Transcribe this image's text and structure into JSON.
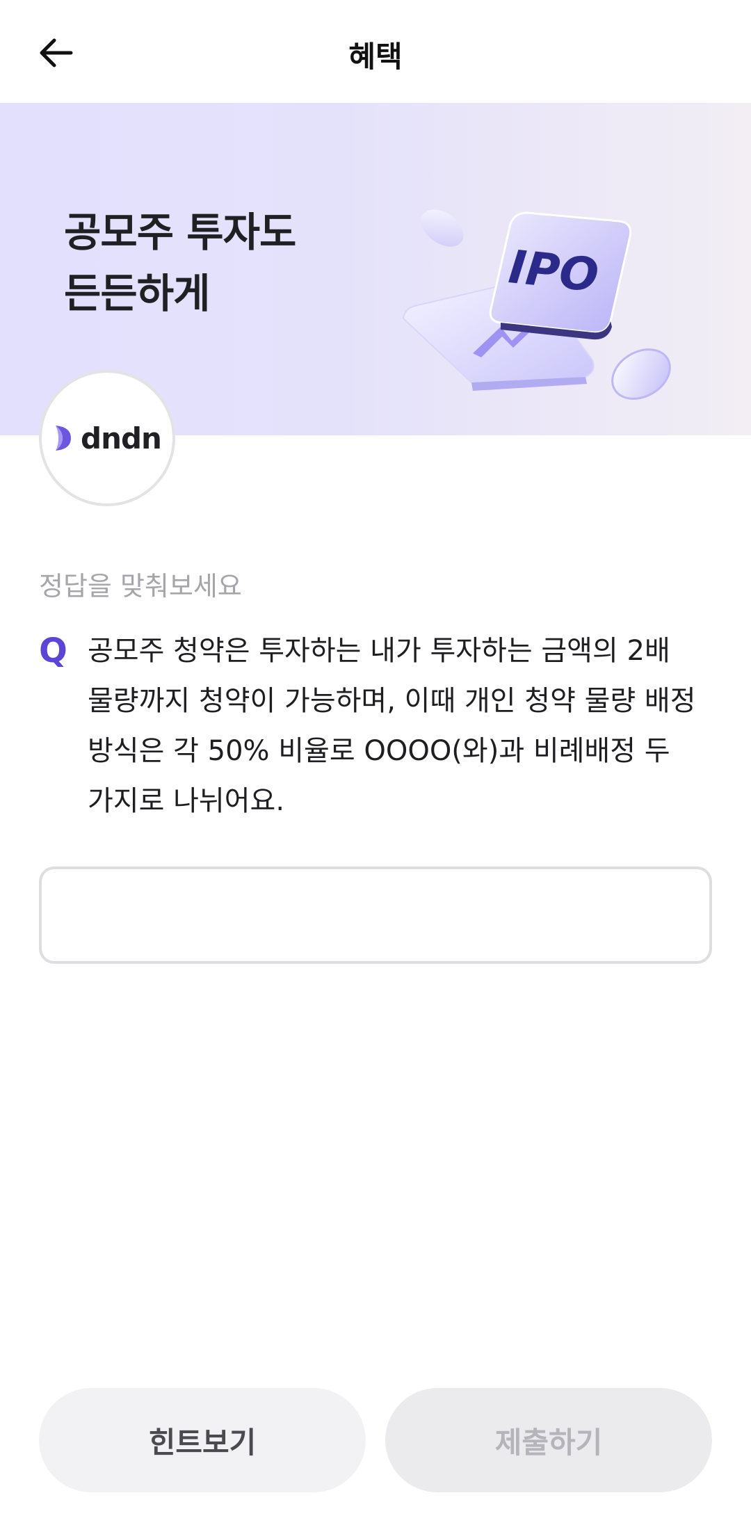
{
  "header": {
    "title": "혜택"
  },
  "banner": {
    "title_line1": "공모주 투자도",
    "title_line2": "든든하게",
    "art_label": "IPO",
    "background_color": "#e2e0fd"
  },
  "brand": {
    "logo_text": "dndn",
    "accent_color": "#5c45d6"
  },
  "quiz": {
    "instruction": "정답을 맞춰보세요",
    "q_mark": "Q",
    "question": "공모주 청약은 투자하는 내가 투자하는 금액의 2배 물량까지 청약이 가능하며, 이때 개인 청약 물량 배정 방식은 각 50% 비율로 OOOO(와)과 비례배정 두 가지로 나뉘어요.",
    "answer_value": "",
    "answer_placeholder": ""
  },
  "buttons": {
    "hint_label": "힌트보기",
    "submit_label": "제출하기"
  },
  "icons": {
    "back": "arrow-left-icon",
    "logo_mark": "crescent-logo-icon"
  }
}
